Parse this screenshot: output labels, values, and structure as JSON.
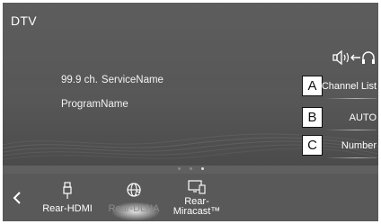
{
  "header": {
    "title": "DTV"
  },
  "audio_button": {
    "icon": "speaker-to-headphones-icon"
  },
  "program_info": {
    "channel": "99.9 ch.",
    "service_name": "ServiceName",
    "program_name": "ProgramName"
  },
  "side_buttons": [
    {
      "marker": "A",
      "label": "Channel List"
    },
    {
      "marker": "B",
      "label": "AUTO"
    },
    {
      "marker": "C",
      "label": "Number"
    }
  ],
  "page_indicator": {
    "total": 3,
    "active": 3
  },
  "bottom_bar": {
    "back_icon": "chevron-left-icon",
    "apps": [
      {
        "label": "Rear-HDMI",
        "icon": "usb-hdmi-icon",
        "state": "normal"
      },
      {
        "label": "Rear-DLNA",
        "icon": "globe-network-icon",
        "state": "dimmed"
      },
      {
        "label_line1": "Rear-",
        "label_line2": "Miracast™",
        "icon": "display-device-icon",
        "state": "normal"
      }
    ]
  },
  "colors": {
    "background": "#5b5b5b",
    "text": "#ffffff",
    "dimmed_text": "#8c8c8c",
    "marker_box": "#ffffff"
  }
}
